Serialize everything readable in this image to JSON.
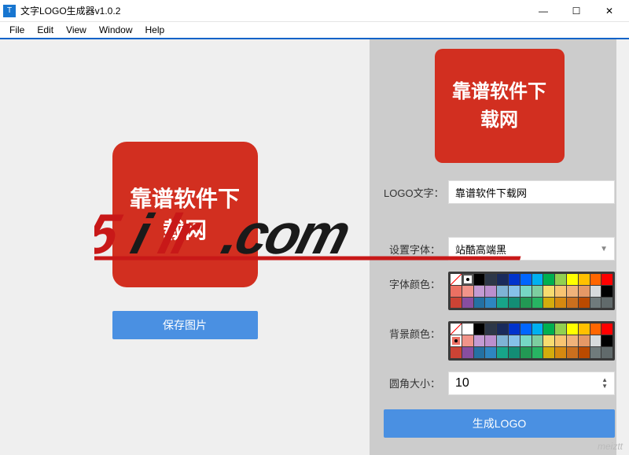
{
  "window": {
    "title": "文字LOGO生成器v1.0.2",
    "min": "—",
    "max": "☐",
    "close": "✕"
  },
  "menu": {
    "file": "File",
    "edit": "Edit",
    "view": "View",
    "window": "Window",
    "help": "Help"
  },
  "preview": {
    "logo_text": "靠谱软件下载网",
    "save_btn": "保存图片"
  },
  "right": {
    "logo_text": "靠谱软件下载网",
    "labels": {
      "logo_text": "LOGO文字：",
      "font": "设置字体：",
      "font_color": "字体颜色：",
      "bg_color": "背景颜色：",
      "radius": "圆角大小："
    },
    "values": {
      "logo_text": "靠谱软件下载网",
      "font": "站酷高端黑",
      "radius": "10"
    },
    "generate_btn": "生成LOGO"
  },
  "palette_colors": [
    "diag",
    "#ffffff",
    "#000000",
    "#2d3748",
    "#1a2b5c",
    "#0033cc",
    "#0066ff",
    "#00b0f0",
    "#00b050",
    "#92d050",
    "#ffff00",
    "#ffc000",
    "#ff6600",
    "#ff0000",
    "#ec7063",
    "#f1948a",
    "#c39bd3",
    "#bb8fce",
    "#7fb3d5",
    "#85c1e9",
    "#76d7c4",
    "#7dcea0",
    "#f7dc6f",
    "#f8c471",
    "#f0b27a",
    "#e59866",
    "#d7dbdd",
    "#000000",
    "#cb4335",
    "#884ea0",
    "#2471a3",
    "#2e86c1",
    "#17a589",
    "#138d75",
    "#229954",
    "#28b463",
    "#d4ac0d",
    "#d68910",
    "#ca6f1e",
    "#ba4a00",
    "#707b7c",
    "#616a6b"
  ],
  "watermark": {
    "text_5": "5",
    "text_i": "i",
    "text_lr": "lr",
    "text_com": ".com",
    "corner": "meiztt"
  }
}
